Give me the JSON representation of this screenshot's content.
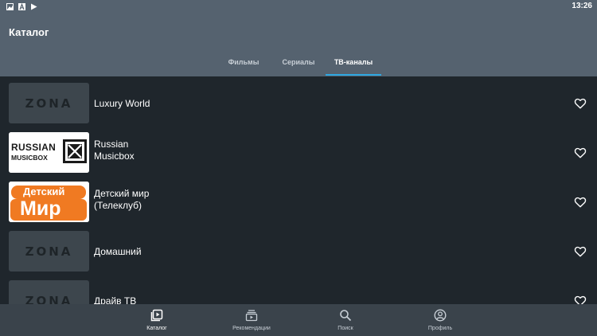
{
  "status_bar": {
    "time": "13:26",
    "icons": [
      "image-icon",
      "font-icon",
      "play-store-icon"
    ]
  },
  "app_bar": {
    "title": "Каталог",
    "tabs": [
      {
        "label": "Фильмы",
        "active": false
      },
      {
        "label": "Сериалы",
        "active": false
      },
      {
        "label": "ТВ-каналы",
        "active": true
      }
    ]
  },
  "channels": [
    {
      "title_line1": "Luxury World",
      "title_line2": "",
      "logo": "zona-placeholder",
      "logo_text": "ZONA"
    },
    {
      "title_line1": "Russian",
      "title_line2": "Musicbox",
      "logo": "russian-musicbox-logo",
      "logo_text_top": "RUSSIAN",
      "logo_text_bottom": "MUSICBOX"
    },
    {
      "title_line1": "Детский мир",
      "title_line2": "(Телеклуб)",
      "logo": "detskiy-mir-logo",
      "logo_text_top": "Детский",
      "logo_text_bottom": "Мир"
    },
    {
      "title_line1": "Домашний",
      "title_line2": "",
      "logo": "zona-placeholder",
      "logo_text": "ZONA"
    },
    {
      "title_line1": "Драйв ТВ",
      "title_line2": "",
      "logo": "zona-placeholder",
      "logo_text": "ZONA"
    }
  ],
  "bottom_nav": [
    {
      "label": "Каталог",
      "icon": "catalog-icon",
      "active": true
    },
    {
      "label": "Рекомендации",
      "icon": "recommendations-icon",
      "active": false
    },
    {
      "label": "Поиск",
      "icon": "search-icon",
      "active": false
    },
    {
      "label": "Профиль",
      "icon": "profile-icon",
      "active": false
    }
  ],
  "colors": {
    "app_bar": "#55626f",
    "background": "#1f262c",
    "tab_indicator": "#2ea7e0",
    "bottom_nav": "#3a434b",
    "detskiy_mir_orange": "#f07a22"
  }
}
